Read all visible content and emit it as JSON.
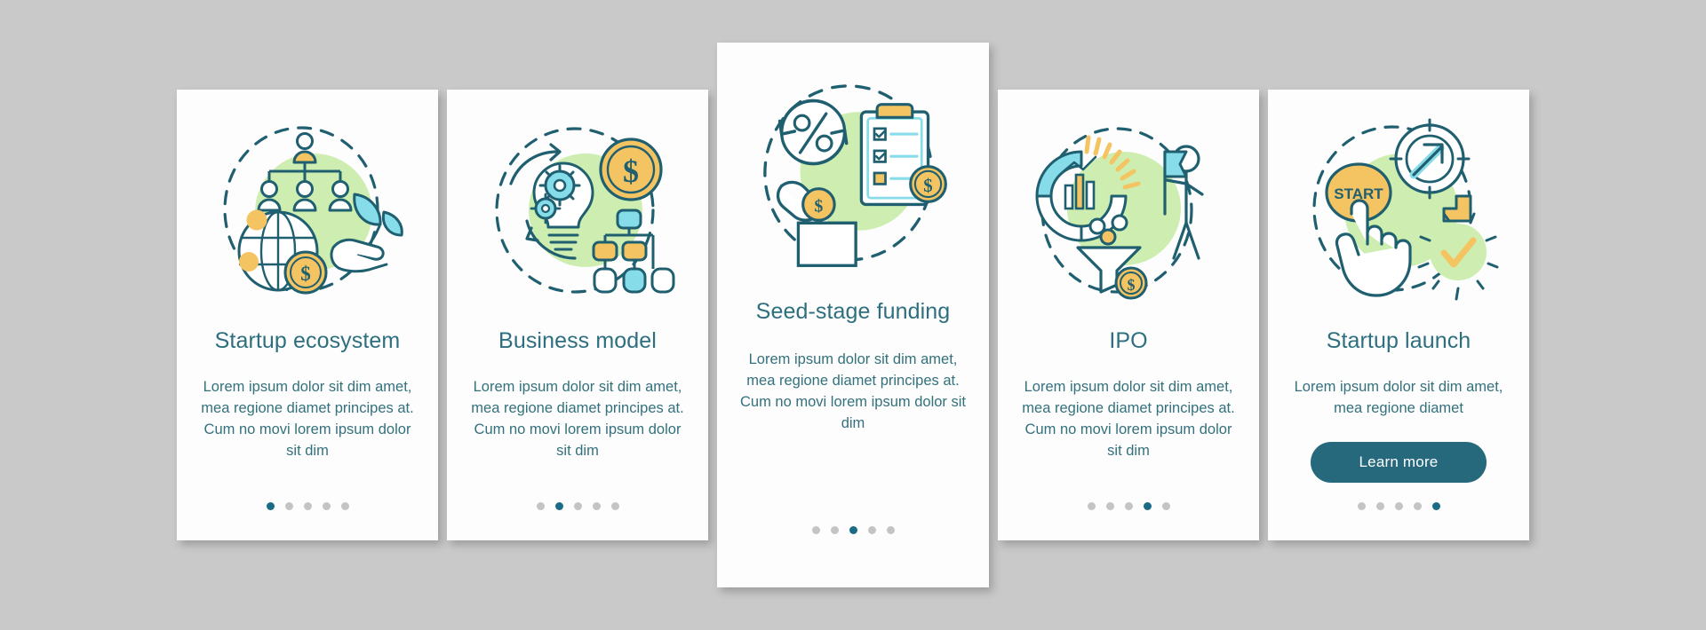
{
  "theme": {
    "background": "#c9c9c9",
    "card_background": "#fdfdfd",
    "title_color": "#2d6f7e",
    "body_color": "#33717c",
    "accent_teal": "#26697d",
    "accent_yellow": "#f5c462",
    "accent_mint": "#6fd6d9",
    "accent_green_blob": "#cdeeb0",
    "dot_inactive": "#c4c4c4",
    "dot_active": "#1b6b86"
  },
  "screens": [
    {
      "id": "startup-ecosystem",
      "icon": "startup-ecosystem-icon",
      "title": "Startup ecosystem",
      "body": "Lorem ipsum dolor sit dim amet, mea regione diamet principes at. Cum no movi lorem ipsum dolor sit dim",
      "dots_total": 5,
      "dot_active_index": 0,
      "button": null,
      "tall": false
    },
    {
      "id": "business-model",
      "icon": "business-model-icon",
      "title": "Business model",
      "body": "Lorem ipsum dolor sit dim amet, mea regione diamet principes at. Cum no movi lorem ipsum dolor sit dim",
      "dots_total": 5,
      "dot_active_index": 1,
      "button": null,
      "tall": false
    },
    {
      "id": "seed-stage-funding",
      "icon": "seed-stage-funding-icon",
      "title": "Seed-stage funding",
      "body": "Lorem ipsum dolor sit dim amet, mea regione diamet principes at. Cum no movi lorem ipsum dolor sit dim",
      "dots_total": 5,
      "dot_active_index": 2,
      "button": null,
      "tall": true
    },
    {
      "id": "ipo",
      "icon": "ipo-icon",
      "title": "IPO",
      "body": "Lorem ipsum dolor sit dim amet, mea regione diamet principes at. Cum no movi lorem ipsum dolor sit dim",
      "dots_total": 5,
      "dot_active_index": 3,
      "button": null,
      "tall": false
    },
    {
      "id": "startup-launch",
      "icon": "startup-launch-icon",
      "title": "Startup launch",
      "body": "Lorem ipsum dolor sit dim amet, mea regione diamet",
      "dots_total": 5,
      "dot_active_index": 4,
      "button": "Learn more",
      "tall": false
    }
  ]
}
